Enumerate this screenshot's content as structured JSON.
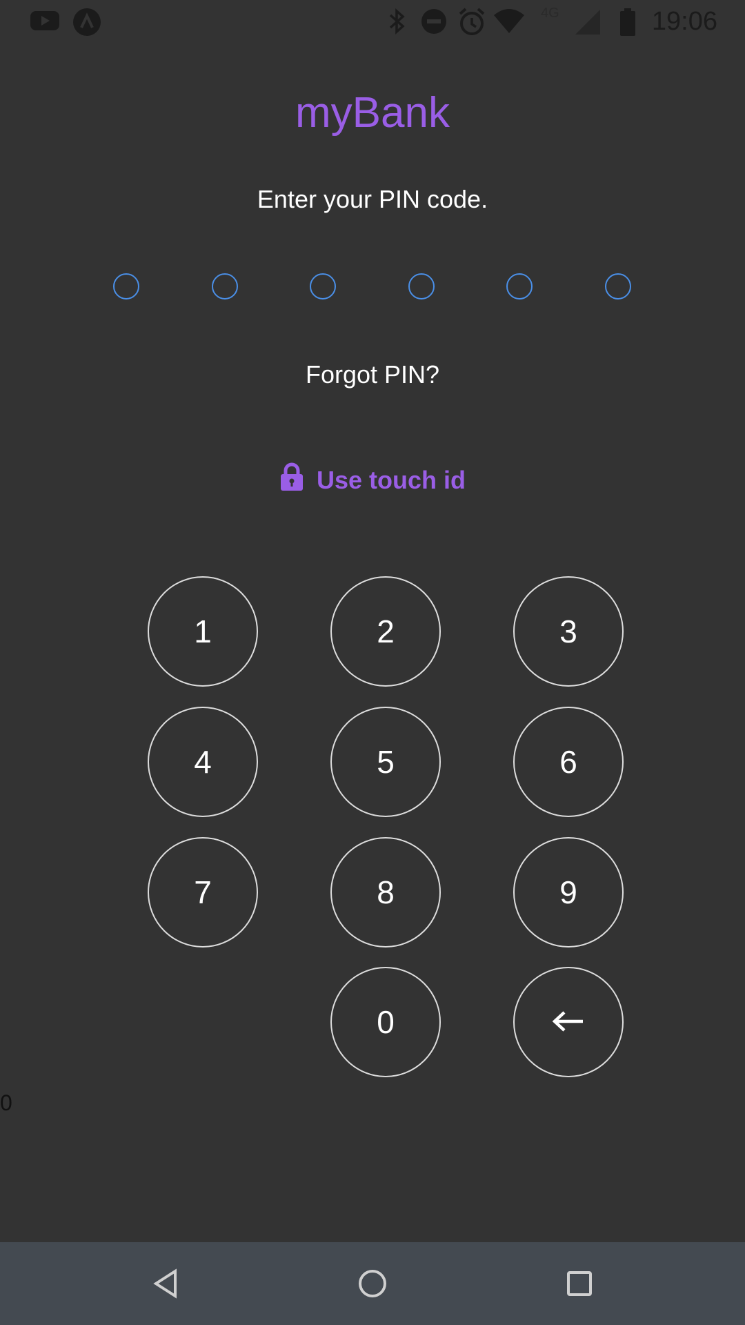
{
  "status_bar": {
    "time": "19:06",
    "network_label": "4G",
    "left_icons": [
      "youtube-icon",
      "app-notification-icon"
    ],
    "right_icons": [
      "bluetooth-icon",
      "do-not-disturb-icon",
      "alarm-icon",
      "wifi-icon",
      "signal-icon",
      "battery-icon"
    ]
  },
  "app": {
    "title": "myBank",
    "prompt": "Enter your PIN code.",
    "pin_length": 6,
    "pin_entered": 0,
    "forgot_label": "Forgot PIN?",
    "touch_id_label": "Use touch id",
    "touch_id_icon": "lock-icon"
  },
  "keypad": {
    "keys": [
      "1",
      "2",
      "3",
      "4",
      "5",
      "6",
      "7",
      "8",
      "9",
      "0"
    ],
    "backspace_icon": "backspace-arrow-icon"
  },
  "stray_text": "0",
  "nav_bar": {
    "buttons": [
      "back-icon",
      "home-icon",
      "recents-icon"
    ]
  },
  "colors": {
    "background": "#333333",
    "accent": "#9a5ee6",
    "pin_dot": "#4a8fe7",
    "key_border": "#dddddd",
    "nav_bar": "#444a51"
  }
}
